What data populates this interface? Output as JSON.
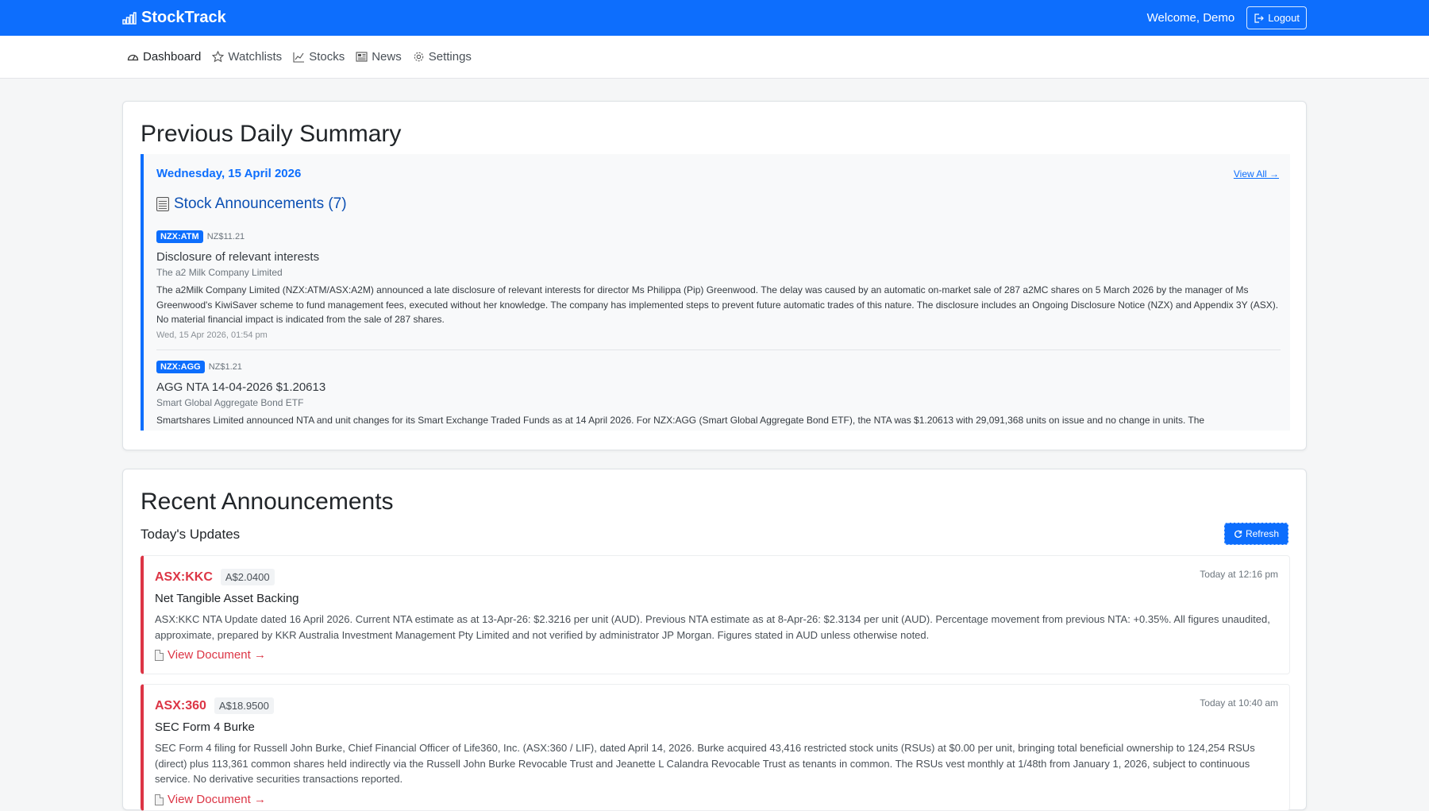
{
  "app": {
    "name": "StockTrack",
    "welcome": "Welcome, Demo",
    "logout_label": "Logout"
  },
  "nav": [
    {
      "label": "Dashboard",
      "icon": "speedometer-icon",
      "active": true
    },
    {
      "label": "Watchlists",
      "icon": "star-icon"
    },
    {
      "label": "Stocks",
      "icon": "graph-up-icon"
    },
    {
      "label": "News",
      "icon": "newspaper-icon"
    },
    {
      "label": "Settings",
      "icon": "gear-icon"
    }
  ],
  "summary": {
    "heading": "Previous Daily Summary",
    "date": "Wednesday, 15 April 2026",
    "view_all": "View All →",
    "announcements_title": "Stock Announcements (7)",
    "items": [
      {
        "ticker": "NZX:ATM",
        "price": "NZ$11.21",
        "title": "Disclosure of relevant interests",
        "company": "The a2 Milk Company Limited",
        "body": "The a2Milk Company Limited (NZX:ATM/ASX:A2M) announced a late disclosure of relevant interests for director Ms Philippa (Pip) Greenwood. The delay was caused by an automatic on-market sale of 287 a2MC shares on 5 March 2026 by the manager of Ms Greenwood's KiwiSaver scheme to fund management fees, executed without her knowledge. The company has implemented steps to prevent future automatic trades of this nature. The disclosure includes an Ongoing Disclosure Notice (NZX) and Appendix 3Y (ASX). No material financial impact is indicated from the sale of 287 shares.",
        "time": "Wed, 15 Apr 2026, 01:54 pm"
      },
      {
        "ticker": "NZX:AGG",
        "price": "NZ$1.21",
        "title": "AGG NTA 14-04-2026 $1.20613",
        "company": "Smart Global Aggregate Bond ETF",
        "body": "Smartshares Limited announced NTA and unit changes for its Smart Exchange Traded Funds as at 14 April 2026. For NZX:AGG (Smart Global Aggregate Bond ETF), the NTA was $1.20613 with 29,091,368 units on issue and no change in units. The",
        "time": ""
      }
    ]
  },
  "recent": {
    "heading": "Recent Announcements",
    "subheading": "Today's Updates",
    "refresh_label": "Refresh",
    "items": [
      {
        "ticker": "ASX:KKC",
        "price": "A$2.0400",
        "time": "Today at 12:16 pm",
        "title": "Net Tangible Asset Backing",
        "body": "ASX:KKC NTA Update dated 16 April 2026. Current NTA estimate as at 13-Apr-26: $2.3216 per unit (AUD). Previous NTA estimate as at 8-Apr-26: $2.3134 per unit (AUD). Percentage movement from previous NTA: +0.35%. All figures unaudited, approximate, prepared by KKR Australia Investment Management Pty Limited and not verified by administrator JP Morgan. Figures stated in AUD unless otherwise noted.",
        "link": "View Document →"
      },
      {
        "ticker": "ASX:360",
        "price": "A$18.9500",
        "time": "Today at 10:40 am",
        "title": "SEC Form 4 Burke",
        "body": "SEC Form 4 filing for Russell John Burke, Chief Financial Officer of Life360, Inc. (ASX:360 / LIF), dated April 14, 2026. Burke acquired 43,416 restricted stock units (RSUs) at $0.00 per unit, bringing total beneficial ownership to 124,254 RSUs (direct) plus 113,361 common shares held indirectly via the Russell John Burke Revocable Trust and Jeanette L Calandra Revocable Trust as tenants in common. The RSUs vest monthly at 1/48th from January 1, 2026, subject to continuous service. No derivative securities transactions reported.",
        "link": "View Document →"
      }
    ]
  },
  "colors": {
    "primary": "#0d6efd",
    "danger": "#dc3545"
  }
}
